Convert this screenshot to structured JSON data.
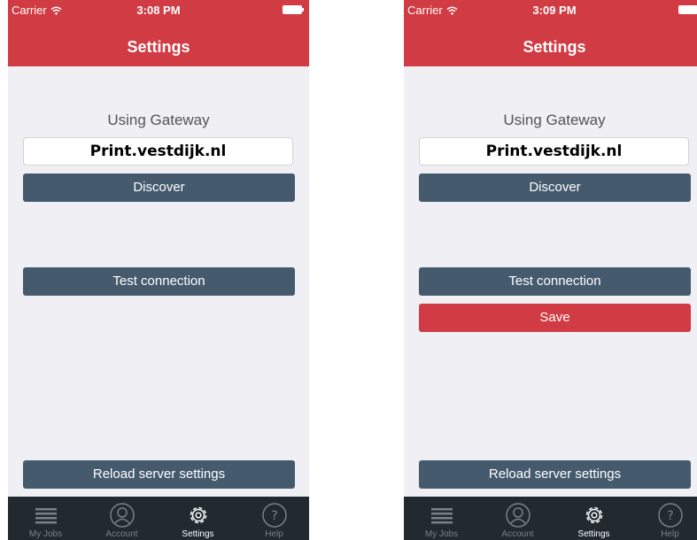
{
  "colors": {
    "header": "#d13b43",
    "dark_button": "#465a6e",
    "save_button": "#d13b43",
    "tab_bar": "#22292f"
  },
  "screens": [
    {
      "carrier": "Carrier",
      "time": "3:08 PM",
      "title": "Settings",
      "gateway_label": "Using Gateway",
      "gateway_value": "Print.vestdijk.nl",
      "discover_label": "Discover",
      "test_label": "Test connection",
      "reload_label": "Reload server settings",
      "tabs": [
        {
          "label": "My Jobs",
          "icon": "list-icon"
        },
        {
          "label": "Account",
          "icon": "account-icon"
        },
        {
          "label": "Settings",
          "icon": "gear-icon",
          "active": true
        },
        {
          "label": "Help",
          "icon": "help-icon"
        }
      ]
    },
    {
      "carrier": "Carrier",
      "time": "3:09 PM",
      "title": "Settings",
      "gateway_label": "Using Gateway",
      "gateway_value": "Print.vestdijk.nl",
      "discover_label": "Discover",
      "test_label": "Test connection",
      "save_label": "Save",
      "reload_label": "Reload server settings",
      "tabs": [
        {
          "label": "My Jobs",
          "icon": "list-icon"
        },
        {
          "label": "Account",
          "icon": "account-icon"
        },
        {
          "label": "Settings",
          "icon": "gear-icon",
          "active": true
        },
        {
          "label": "Help",
          "icon": "help-icon"
        }
      ]
    }
  ]
}
